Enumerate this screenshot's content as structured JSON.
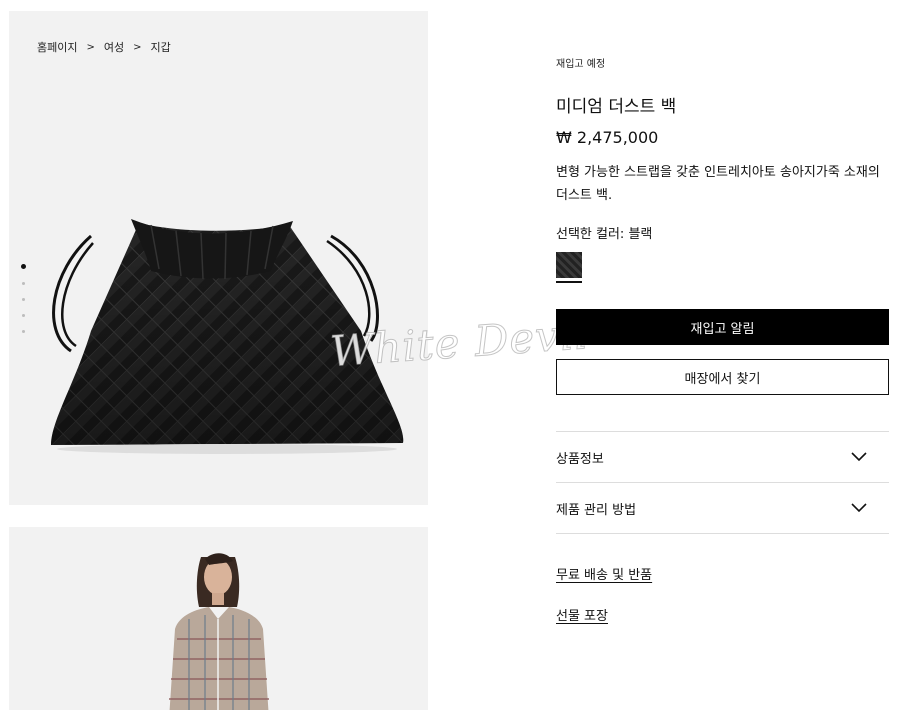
{
  "breadcrumb": {
    "items": [
      "홈페이지",
      "여성",
      "지갑"
    ],
    "separator": ">"
  },
  "gallery": {
    "slide_count": 5,
    "active_index": 0,
    "bag_color": "#1c1c1c"
  },
  "watermark": {
    "text": "White Devil"
  },
  "product": {
    "restock_note": "재입고 예정",
    "title": "미디엄 더스트 백",
    "price": "₩ 2,475,000",
    "description": "변형 가능한 스트랩을 갖춘 인트레치아토 송아지가죽 소재의 더스트 백.",
    "selected_color_label": "선택한 컬러: 블랙",
    "swatch_color": "#2a2a2a"
  },
  "actions": {
    "notify_restock": "재입고 알림",
    "find_in_store": "매장에서 찾기"
  },
  "accordion": {
    "product_info": "상품정보",
    "care": "제품 관리 방법"
  },
  "links": {
    "shipping": "무료 배송 및 반품",
    "gift": "선물 포장"
  }
}
